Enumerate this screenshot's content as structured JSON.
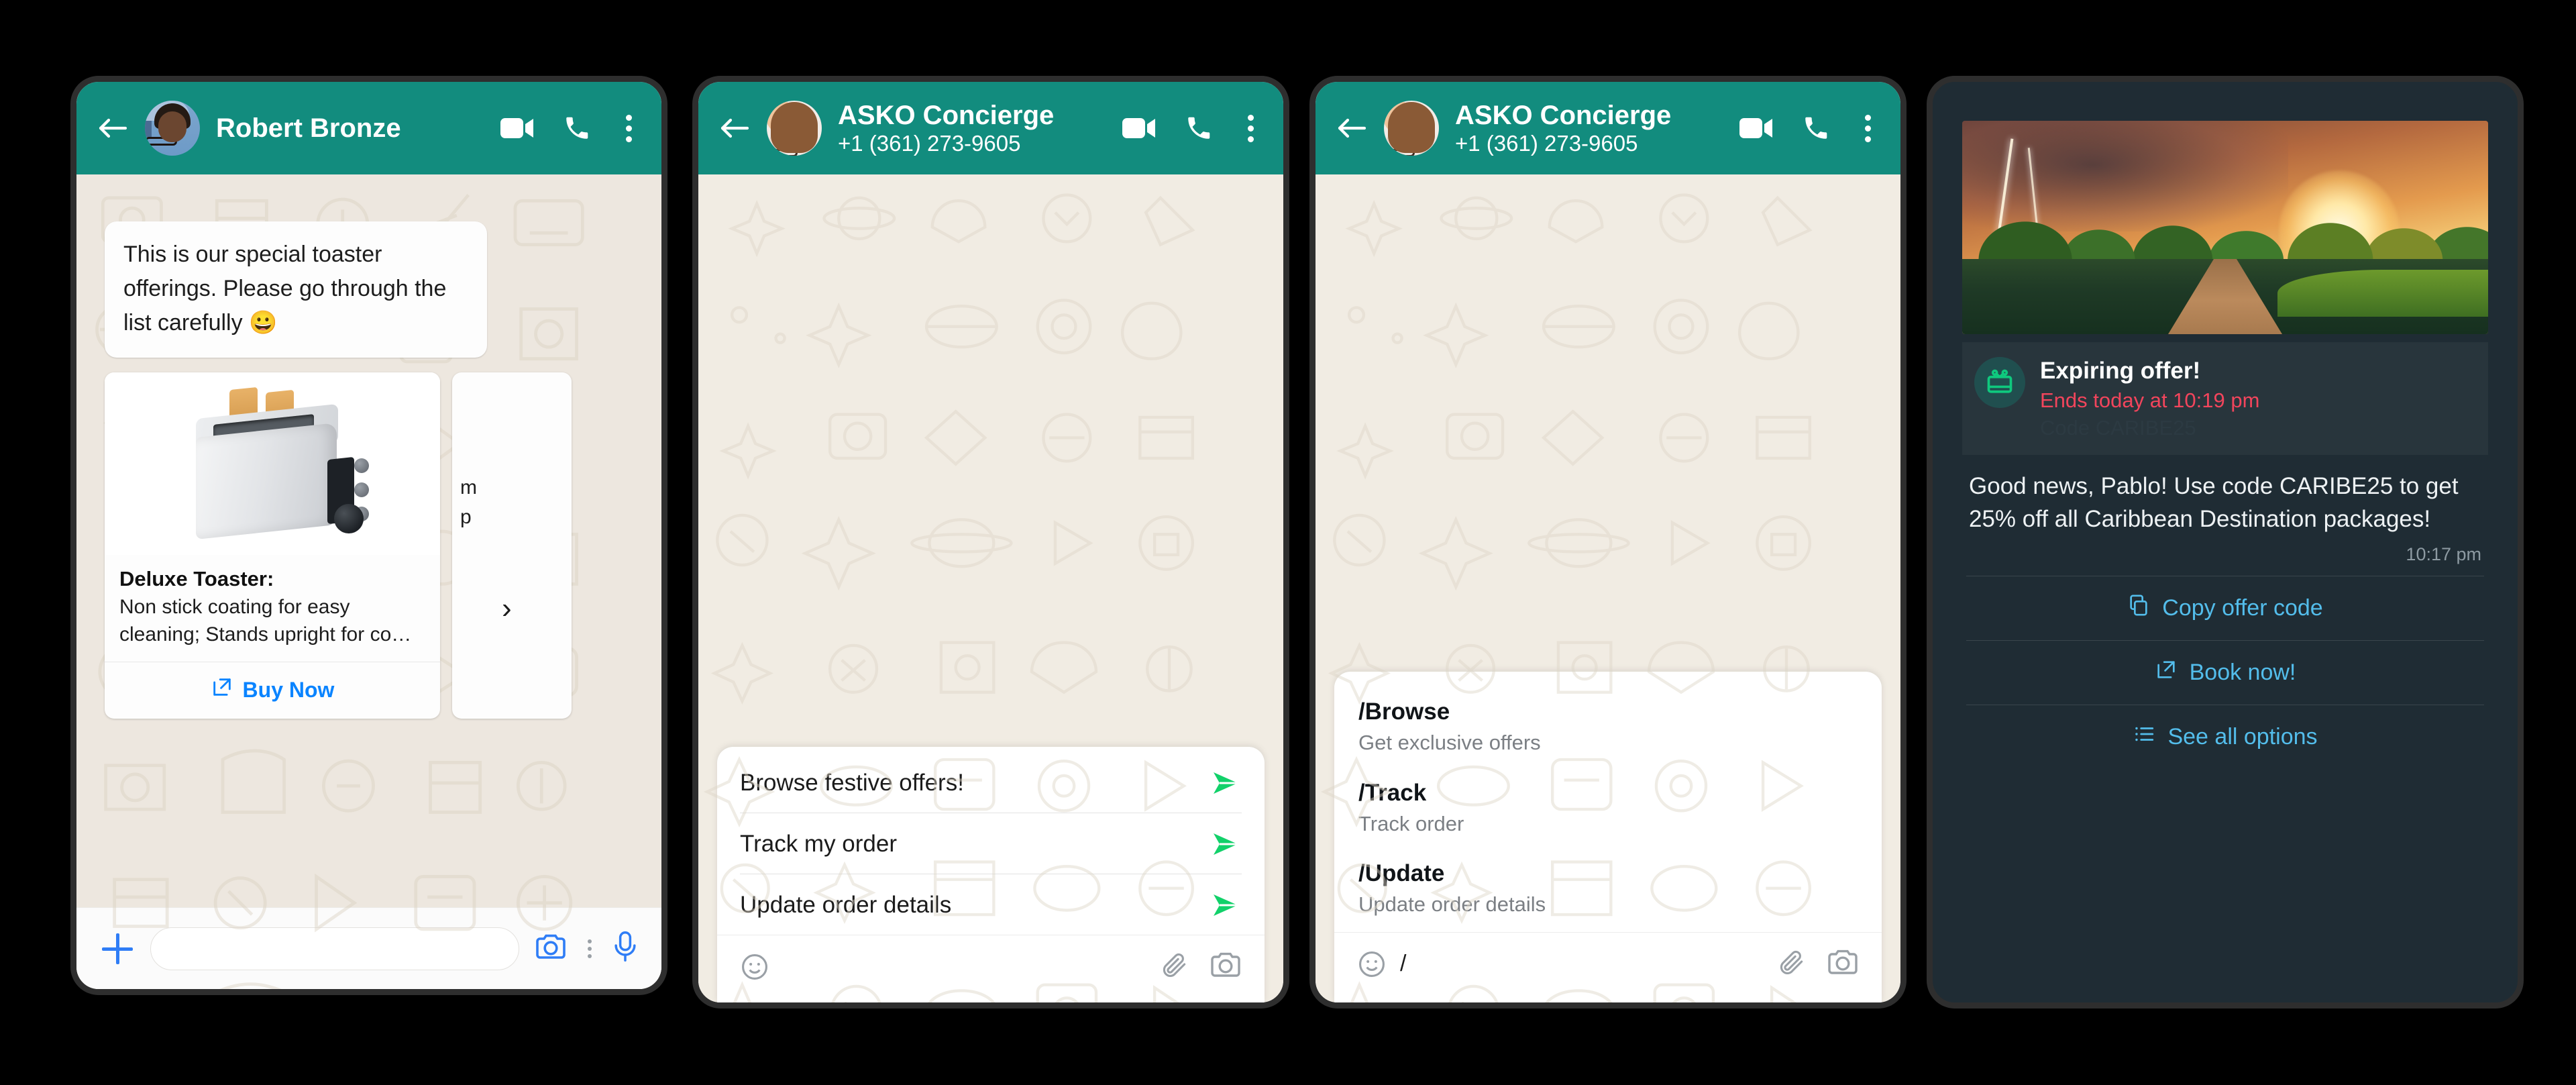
{
  "panels": [
    {
      "header": {
        "name": "Robert Bronze",
        "subtitle": "",
        "back_icon": "back-arrow-icon",
        "video_icon": "video-call-icon",
        "call_icon": "phone-call-icon",
        "menu_icon": "overflow-menu-icon"
      },
      "message": "This is our special toaster offerings. Please go through the list carefully 😀",
      "card": {
        "title": "Deluxe Toaster:",
        "description": "Non stick coating for easy cleaning; Stands upright for co…",
        "action_label": "Buy Now",
        "action_icon": "external-link-icon"
      },
      "peek_card_lines": [
        "m",
        "p"
      ],
      "next_arrow": "›",
      "input": {
        "plus_icon": "plus-icon",
        "placeholder": "",
        "value": "",
        "camera_icon": "camera-icon",
        "more_icon": "more-dots-icon",
        "mic_icon": "microphone-icon"
      }
    },
    {
      "header": {
        "name": "ASKO Concierge",
        "subtitle": "+1 (361) 273-9605",
        "back_icon": "back-arrow-icon",
        "video_icon": "video-call-icon",
        "call_icon": "phone-call-icon",
        "menu_icon": "overflow-menu-icon"
      },
      "quick_replies": [
        {
          "label": "Browse festive offers!",
          "send_icon": "send-arrow-icon"
        },
        {
          "label": "Track my order",
          "send_icon": "send-arrow-icon"
        },
        {
          "label": "Update order details",
          "send_icon": "send-arrow-icon"
        }
      ],
      "compose": {
        "emoji_icon": "emoji-smiley-icon",
        "value": "",
        "attach_icon": "paperclip-icon",
        "camera_icon": "camera-icon"
      }
    },
    {
      "header": {
        "name": "ASKO Concierge",
        "subtitle": "+1 (361) 273-9605",
        "back_icon": "back-arrow-icon",
        "video_icon": "video-call-icon",
        "call_icon": "phone-call-icon",
        "menu_icon": "overflow-menu-icon"
      },
      "commands": [
        {
          "name": "/Browse",
          "desc": "Get exclusive offers"
        },
        {
          "name": "/Track",
          "desc": "Track order"
        },
        {
          "name": "/Update",
          "desc": "Update order details"
        }
      ],
      "compose": {
        "emoji_icon": "emoji-smiley-icon",
        "value": "/",
        "attach_icon": "paperclip-icon",
        "camera_icon": "camera-icon"
      }
    },
    {
      "hero_alt": "sunset boardwalk over lake with lightning",
      "banner": {
        "icon": "gift-card-icon",
        "title": "Expiring offer!",
        "subtitle": "Ends today at 10:19 pm",
        "code_line": "Code  CARIBE25"
      },
      "message": "Good news, Pablo! Use code CARIBE25 to get 25% off all Caribbean Destination packages!",
      "timestamp": "10:17 pm",
      "actions": [
        {
          "label": "Copy offer code",
          "icon": "copy-icon"
        },
        {
          "label": "Book now!",
          "icon": "external-link-icon"
        },
        {
          "label": "See all options",
          "icon": "list-icon"
        }
      ]
    }
  ],
  "colors": {
    "whatsapp_green": "#128C7E",
    "send_green": "#12D16A",
    "link_blue": "#0A84FF",
    "dark_link_blue": "#53BDEB",
    "expiry_red": "#F2455C",
    "dark_bg": "#1F2C34",
    "chat_bg": "#EDE7DF",
    "chat_bg_light": "#F1ECE3",
    "gift_green": "#0FC97E"
  }
}
